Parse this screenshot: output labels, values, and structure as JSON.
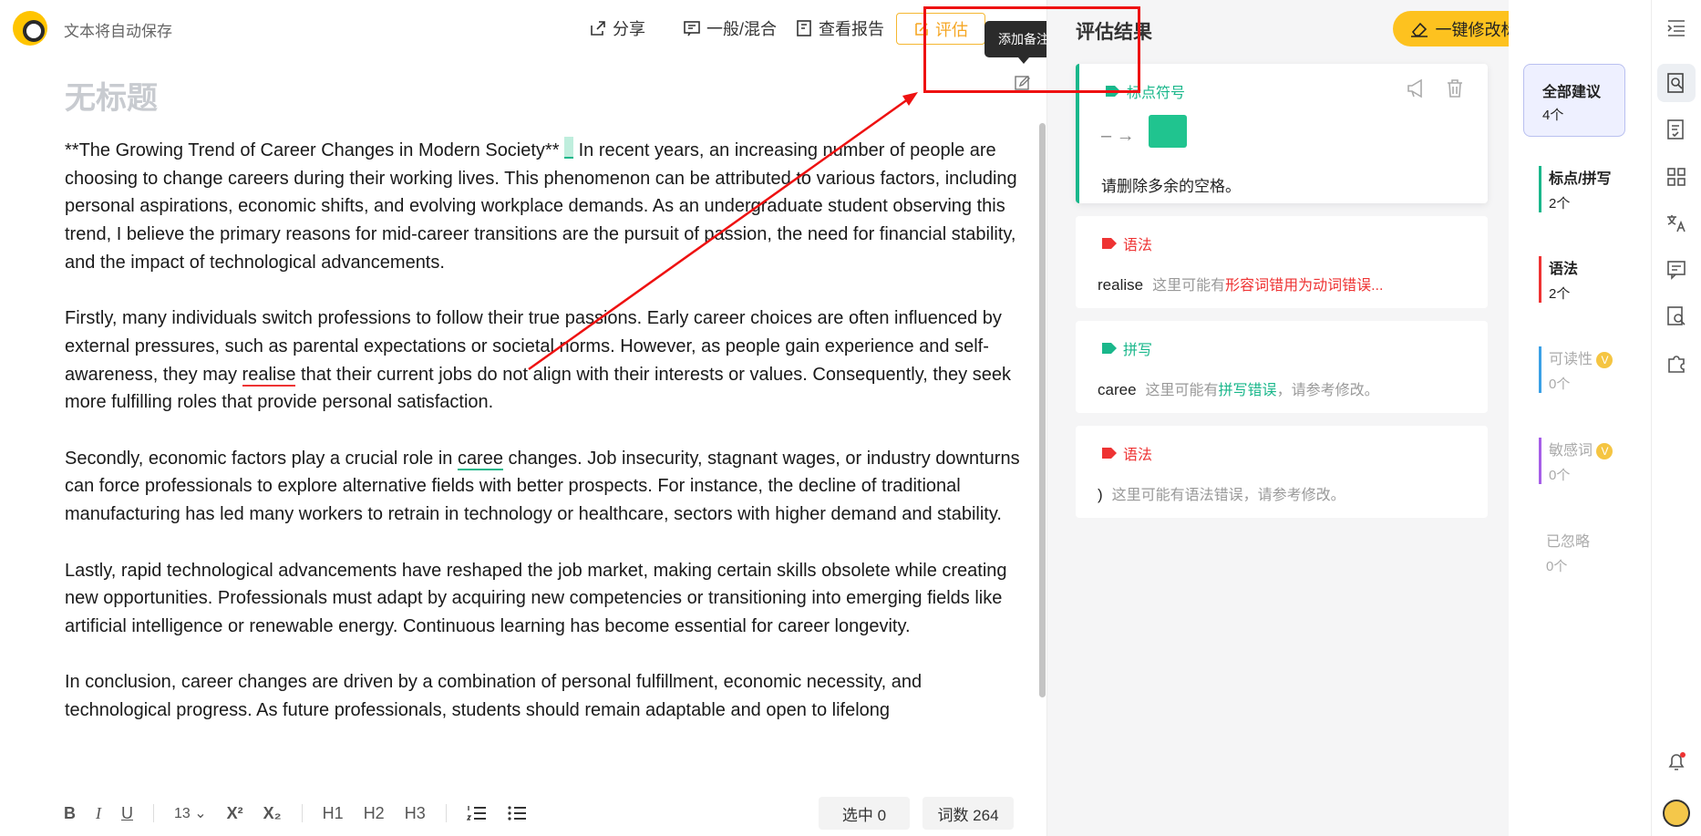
{
  "header": {
    "autosave_text": "文本将自动保存",
    "share_label": "分享",
    "mode_label": "一般/混合",
    "report_label": "查看报告",
    "evaluate_label": "评估",
    "tooltip_text": "添加备注"
  },
  "editor": {
    "title": "无标题",
    "paragraphs": [
      [
        "**The Growing Trend of Career Changes in Modern Society** ",
        "",
        " In recent years, an increasing number of people are choosing to change careers during their working lives. This phenomenon can be attributed to various factors, including personal aspirations, economic shifts, and evolving workplace demands. As an undergraduate student observing this trend, I believe the primary reasons for mid-career transitions are the pursuit of passion, the need for financial stability, and the impact of technological advancements."
      ],
      [
        "Firstly, many individuals switch professions to follow their true passions. Early career choices are often influenced by external pressures, such as parental expectations or societal norms. However, as people gain experience and self-awareness, they may ",
        "realise",
        " that their current jobs do not align with their interests or values. Consequently, they seek more fulfilling roles that provide personal satisfaction."
      ],
      [
        "Secondly, economic factors play a crucial role in ",
        "caree",
        " changes. Job insecurity, stagnant wages, or industry downturns can force professionals to explore alternative fields with better prospects. For instance, the decline of traditional manufacturing has led many workers to retrain in technology or healthcare, sectors with higher demand and stability."
      ],
      [
        "Lastly, rapid technological advancements have reshaped the job market, making certain skills obsolete while creating new opportunities. Professionals must adapt by acquiring new competencies or transitioning into emerging fields like artificial intelligence or renewable energy. Continuous learning has become essential for career longevity."
      ],
      [
        "In conclusion, career changes are driven by a combination of personal fulfillment, economic necessity, and technological progress. As future professionals, students should remain adaptable and open to lifelong"
      ]
    ],
    "toolbar": {
      "bold": "B",
      "italic": "I",
      "underline": "U",
      "font_size": "13",
      "superscript": "X²",
      "subscript": "X₂",
      "h1": "H1",
      "h2": "H2",
      "h3": "H3"
    },
    "selected": "选中 0",
    "word_count": "词数 264"
  },
  "panel": {
    "title": "评估结果",
    "fix_all_label": "一键修改标点/拼写错误",
    "cards": [
      {
        "tag": "标点符号",
        "tag_color": "#1ab78b",
        "body": "请删除多余的空格。"
      },
      {
        "tag": "语法",
        "tag_color": "#e33",
        "word": "realise",
        "pre": "这里可能有",
        "highlight": "形容词错用为动词错误...",
        "highlight_color": "#e33",
        "post": ""
      },
      {
        "tag": "拼写",
        "tag_color": "#1ab78b",
        "word": "caree",
        "pre": "这里可能有",
        "highlight": "拼写错误",
        "highlight_color": "#1ab78b",
        "post": "，请参考修改。"
      },
      {
        "tag": "语法",
        "tag_color": "#e33",
        "word": ")",
        "pre": "这里可能有语法错误，请参考修改。",
        "highlight": "",
        "highlight_color": "#e33",
        "post": ""
      }
    ],
    "filters": [
      {
        "label": "全部建议",
        "count": "4个",
        "color": "#222"
      },
      {
        "label": "标点/拼写",
        "count": "2个",
        "color": "#1ab78b"
      },
      {
        "label": "语法",
        "count": "2个",
        "color": "#e33"
      },
      {
        "label": "可读性",
        "count": "0个",
        "color": "#3aa0e6"
      },
      {
        "label": "敏感词",
        "count": "0个",
        "color": "#a65ee8"
      },
      {
        "label": "已忽略",
        "count": "0个",
        "color": "#aaa"
      }
    ]
  },
  "colors": {
    "brand": "#fdc21f",
    "annotation": "#e11"
  }
}
